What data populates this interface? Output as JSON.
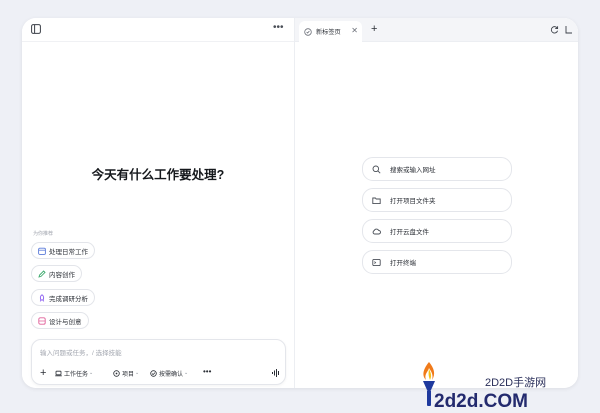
{
  "left_pane": {
    "headline": "今天有什么工作要处理?",
    "suggest_caption": "为你推荐",
    "suggestions": [
      {
        "label": "处理日常工作",
        "icon": "calendar-icon"
      },
      {
        "label": "内容创作",
        "icon": "pen-icon"
      },
      {
        "label": "完成调研分析",
        "icon": "rocket-icon"
      },
      {
        "label": "设计与创意",
        "icon": "palette-icon"
      }
    ],
    "composer": {
      "placeholder": "输入问题或任务，/ 选择技能",
      "tools": [
        {
          "label": "工作任务",
          "icon": "laptop-icon"
        },
        {
          "label": "项目",
          "icon": "project-icon"
        },
        {
          "label": "按需确认",
          "icon": "check-circle-icon"
        }
      ]
    }
  },
  "right_pane": {
    "tab": {
      "label": "新标签页",
      "icon": "browser-tab-icon"
    },
    "quick_actions": [
      {
        "label": "搜索或输入网址",
        "icon": "search-icon"
      },
      {
        "label": "打开项目文件夹",
        "icon": "folder-icon"
      },
      {
        "label": "打开云盘文件",
        "icon": "cloud-icon"
      },
      {
        "label": "打开终端",
        "icon": "terminal-icon"
      }
    ]
  },
  "watermark": {
    "top_text": "2D2D手游网",
    "main_text": "2d2d.COM"
  },
  "colors": {
    "background": "#eef0f6",
    "window": "#ffffff",
    "border": "#e4e6eb",
    "accent_purple": "#7b5cf5",
    "watermark_blue": "#232a6e"
  }
}
